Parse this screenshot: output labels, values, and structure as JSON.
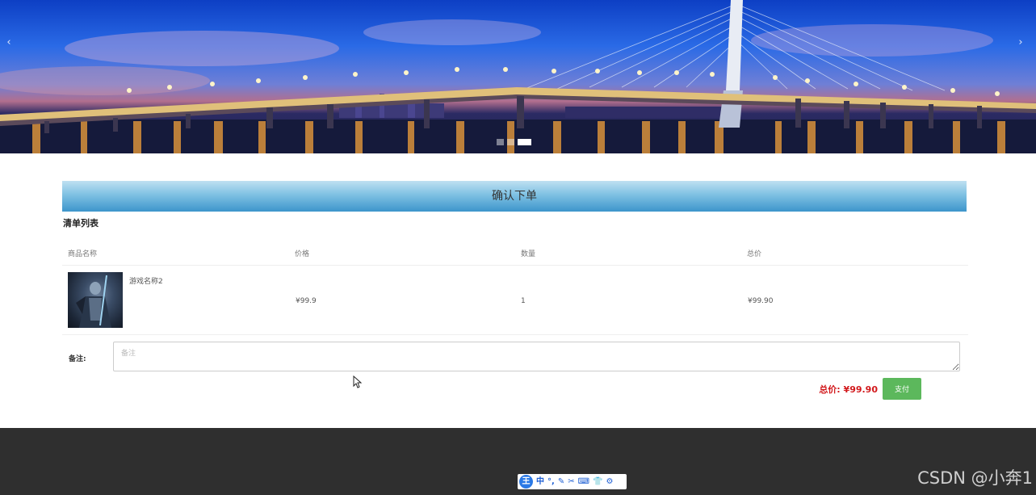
{
  "banner": {
    "prev_arrow": "‹",
    "next_arrow": "›",
    "slide_count": 3,
    "active_slide": 3
  },
  "order": {
    "title": "确认下单",
    "list_title": "清单列表",
    "columns": {
      "name": "商品名称",
      "price": "价格",
      "quantity": "数量",
      "total": "总价"
    },
    "rows": [
      {
        "name": "游戏名称2",
        "price": "¥99.9",
        "quantity": "1",
        "total": "¥99.90",
        "image_icon": "game-character-thumbnail"
      }
    ],
    "remark_label": "备注:",
    "remark_placeholder": "备注",
    "remark_value": "",
    "grand_total": "总价: ¥99.90",
    "pay_label": "支付"
  },
  "ime_toolbar": {
    "logo": "王",
    "mode": "中",
    "items": [
      "°,",
      "✎",
      "✂",
      "⌨",
      "👕",
      "⚙"
    ]
  },
  "watermark": "CSDN @小奔1",
  "colors": {
    "header_bar": "#3d95cb",
    "total_text": "#d2191c",
    "pay_button": "#5cb85c",
    "footer": "#2f2f2f"
  }
}
